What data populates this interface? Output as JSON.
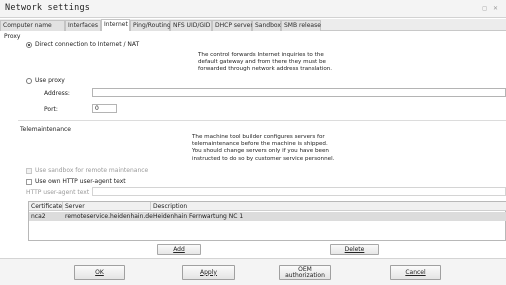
{
  "window": {
    "title": "Network settings",
    "controls": "◻ ✕"
  },
  "tabs": [
    "Computer name",
    "Interfaces",
    "Internet",
    "Ping/Routing",
    "NFS UID/GID",
    "DHCP server",
    "Sandbox",
    "SMB release"
  ],
  "active_tab": "Internet",
  "proxy": {
    "group_label": "Proxy",
    "direct_label": "Direct connection to Internet / NAT",
    "direct_selected": true,
    "direct_note": "The control forwards Internet inquiries to the\ndefault gateway and from there they must be\nforwarded through network address translation.",
    "use_proxy_label": "Use proxy",
    "address_label": "Address:",
    "address_value": "",
    "port_label": "Port:",
    "port_value": "0"
  },
  "telemaintenance": {
    "group_label": "Telemaintenance",
    "note": "The machine tool builder configures servers for\ntelemaintenance before the machine is shipped.\nYou should change servers only if you have been\ninstructed to do so by customer service personnel.",
    "sandbox_label": "Use sandbox for remote maintenance",
    "own_agent_label": "Use own HTTP user-agent text",
    "agent_text_label": "HTTP user-agent text",
    "agent_text_value": ""
  },
  "table": {
    "columns": [
      "Certificate",
      "Server",
      "Description"
    ],
    "rows": [
      {
        "certificate": "nca2",
        "server": "remoteservice.heidenhain.de",
        "description": "Heidenhain Fernwartung NC 1"
      }
    ],
    "add_label": "Add",
    "delete_label": "Delete"
  },
  "footer": {
    "ok": "OK",
    "apply": "Apply",
    "oem_line1": "OEM",
    "oem_line2": "authorization",
    "cancel": "Cancel"
  }
}
